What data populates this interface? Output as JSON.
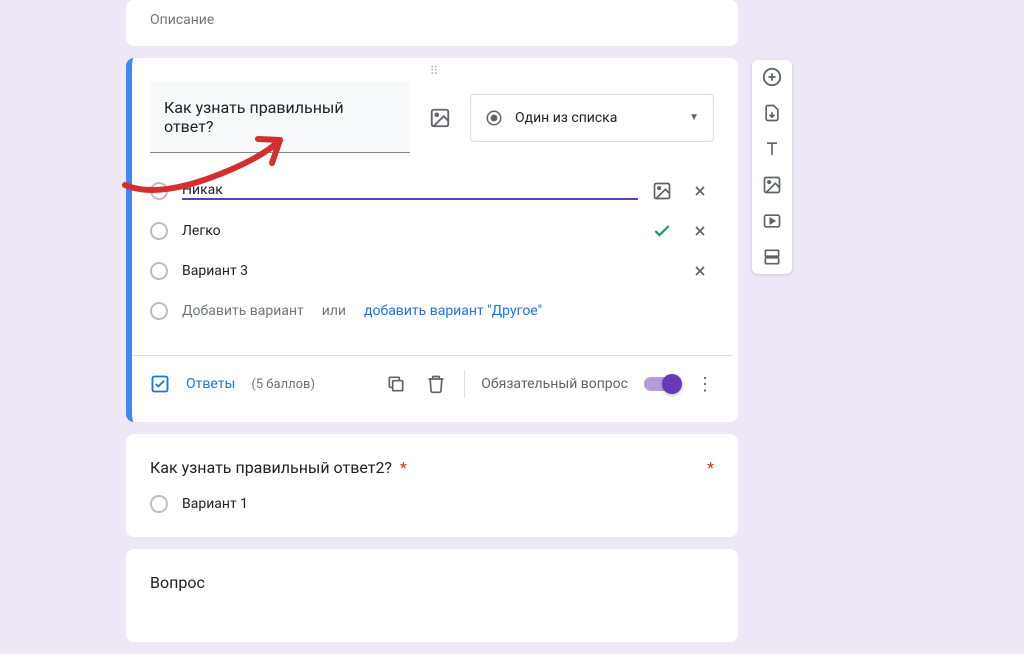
{
  "description_card": {
    "label": "Описание"
  },
  "question_card": {
    "title": "Как узнать правильный ответ?",
    "type_label": "Один из списка",
    "options": [
      {
        "text": "Никак",
        "has_image_btn": true,
        "has_check": false,
        "has_close": true,
        "focused": true
      },
      {
        "text": "Легко",
        "has_image_btn": false,
        "has_check": true,
        "has_close": true,
        "focused": false
      },
      {
        "text": "Вариант 3",
        "has_image_btn": false,
        "has_check": false,
        "has_close": true,
        "focused": false
      }
    ],
    "add_option_label": "Добавить вариант",
    "add_or": "или",
    "add_other_label": "добавить вариант \"Другое\"",
    "answers_label": "Ответы",
    "points_label": "(5 баллов)",
    "required_label": "Обязательный вопрос"
  },
  "question2_card": {
    "title": "Как узнать правильный ответ2?",
    "option1": "Вариант 1"
  },
  "question3_card": {
    "title": "Вопрос"
  },
  "sidebar_tools": [
    "add-question",
    "import-questions",
    "add-title",
    "add-image",
    "add-video",
    "add-section"
  ]
}
